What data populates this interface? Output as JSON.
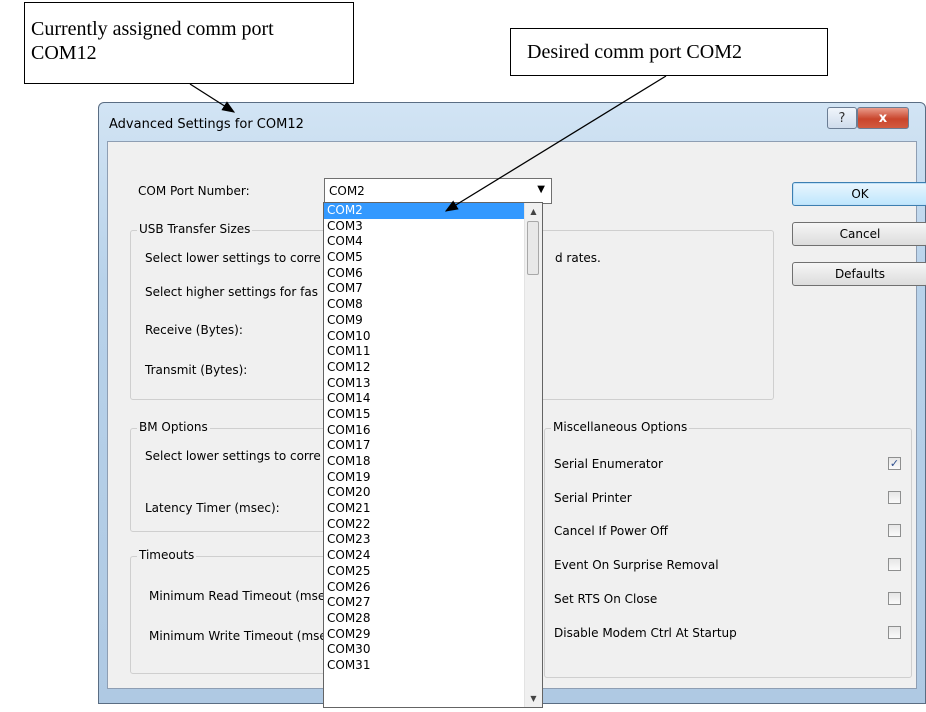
{
  "callouts": {
    "current_line1": "Currently assigned comm port",
    "current_line2": "COM12",
    "desired": "Desired comm port COM2"
  },
  "window": {
    "title": "Advanced Settings for COM12",
    "help_label": "?",
    "close_label": "x"
  },
  "com_port": {
    "label": "COM Port Number:",
    "value": "COM2",
    "options": [
      "COM2",
      "COM3",
      "COM4",
      "COM5",
      "COM6",
      "COM7",
      "COM8",
      "COM9",
      "COM10",
      "COM11",
      "COM12",
      "COM13",
      "COM14",
      "COM15",
      "COM16",
      "COM17",
      "COM18",
      "COM19",
      "COM20",
      "COM21",
      "COM22",
      "COM23",
      "COM24",
      "COM25",
      "COM26",
      "COM27",
      "COM28",
      "COM29",
      "COM30",
      "COM31"
    ]
  },
  "usb": {
    "title": "USB Transfer Sizes",
    "line1": "Select lower settings to corre",
    "line1_tail": "d rates.",
    "line2": "Select higher settings for fas",
    "receive": "Receive (Bytes):",
    "transmit": "Transmit (Bytes):"
  },
  "bm": {
    "title": "BM Options",
    "line1": "Select lower settings to corre",
    "latency": "Latency Timer (msec):"
  },
  "timeouts": {
    "title": "Timeouts",
    "read": "Minimum Read Timeout (mse",
    "write": "Minimum Write Timeout (mse"
  },
  "misc": {
    "title": "Miscellaneous Options",
    "options": [
      {
        "label": "Serial Enumerator",
        "checked": true
      },
      {
        "label": "Serial Printer",
        "checked": false
      },
      {
        "label": "Cancel If Power Off",
        "checked": false
      },
      {
        "label": "Event On Surprise Removal",
        "checked": false
      },
      {
        "label": "Set RTS On Close",
        "checked": false
      },
      {
        "label": "Disable Modem Ctrl At Startup",
        "checked": false
      }
    ]
  },
  "buttons": {
    "ok": "OK",
    "cancel": "Cancel",
    "defaults": "Defaults"
  }
}
